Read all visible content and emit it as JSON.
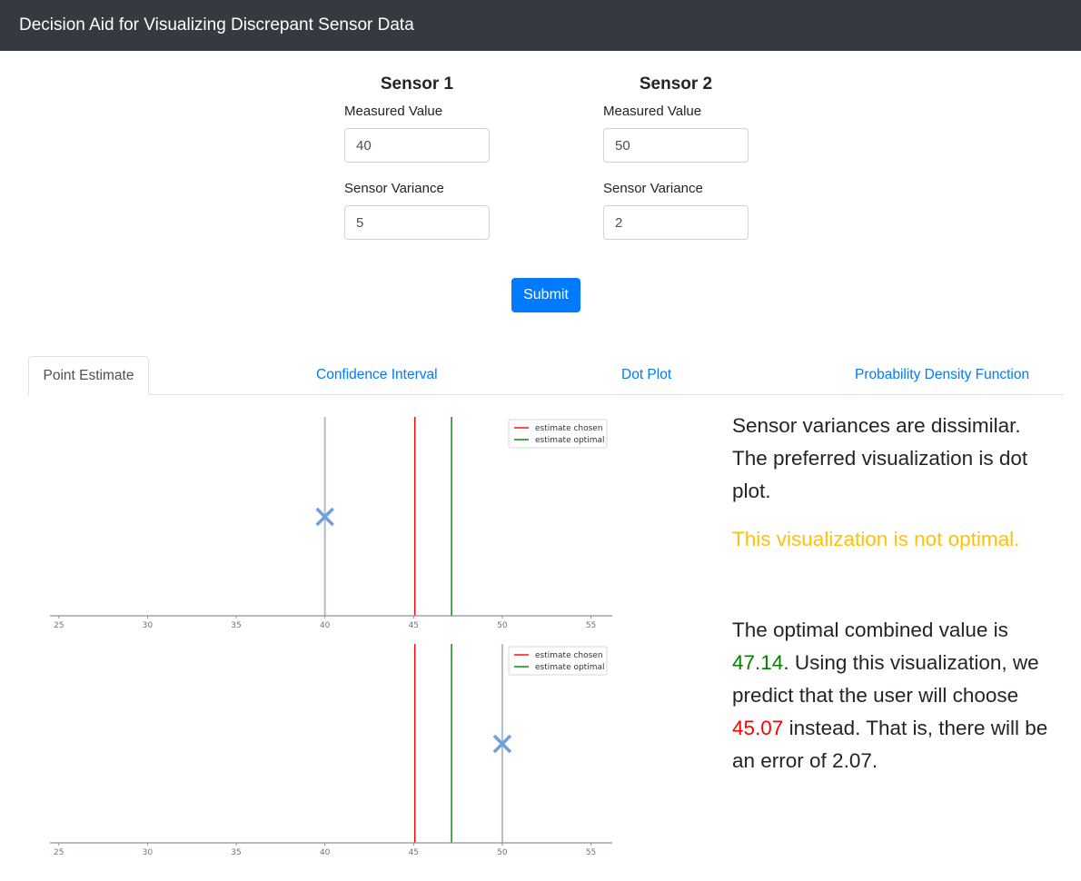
{
  "app": {
    "title": "Decision Aid for Visualizing Discrepant Sensor Data"
  },
  "sensors": [
    {
      "title": "Sensor 1",
      "measured_label": "Measured Value",
      "measured_value": "40",
      "variance_label": "Sensor Variance",
      "variance_value": "5"
    },
    {
      "title": "Sensor 2",
      "measured_label": "Measured Value",
      "measured_value": "50",
      "variance_label": "Sensor Variance",
      "variance_value": "2"
    }
  ],
  "submit_label": "Submit",
  "tabs": [
    {
      "label": "Point Estimate",
      "active": true
    },
    {
      "label": "Confidence Interval",
      "active": false
    },
    {
      "label": "Dot Plot",
      "active": false
    },
    {
      "label": "Probability Density Function",
      "active": false
    }
  ],
  "colors": {
    "navbar": "#343a40",
    "primary": "#007bff",
    "warning": "#ffc107",
    "estimate_chosen": "#ff0000",
    "estimate_optimal": "#008000",
    "marker": "#6f9fdc"
  },
  "chart_data": [
    {
      "type": "scatter",
      "title": "",
      "xlabel": "",
      "ylabel": "",
      "xlim": [
        24.5,
        56.2
      ],
      "xticks": [
        25,
        30,
        35,
        40,
        45,
        50,
        55
      ],
      "marker": {
        "x": 40,
        "symbol": "x"
      },
      "vlines": [
        {
          "name": "estimate chosen",
          "x": 45.07,
          "color": "#ff0000"
        },
        {
          "name": "estimate optimal",
          "x": 47.14,
          "color": "#008000"
        }
      ],
      "legend": "top-right",
      "grid": false
    },
    {
      "type": "scatter",
      "title": "",
      "xlabel": "",
      "ylabel": "",
      "xlim": [
        24.5,
        56.2
      ],
      "xticks": [
        25,
        30,
        35,
        40,
        45,
        50,
        55
      ],
      "marker": {
        "x": 50,
        "symbol": "x"
      },
      "vlines": [
        {
          "name": "estimate chosen",
          "x": 45.07,
          "color": "#ff0000"
        },
        {
          "name": "estimate optimal",
          "x": 47.14,
          "color": "#008000"
        }
      ],
      "legend": "top-right",
      "grid": false
    }
  ],
  "result": {
    "variance_text": "Sensor variances are dissimilar. The preferred visualization is dot plot.",
    "warning": "This visualization is not optimal.",
    "p2_intro": "The optimal combined value is",
    "optimal_value": "47.14",
    "p2_mid": ". Using this visualization, we predict that the user will choose",
    "chosen_value": "45.07",
    "p2_end": "instead. That is, there will be an error of 2.07."
  }
}
